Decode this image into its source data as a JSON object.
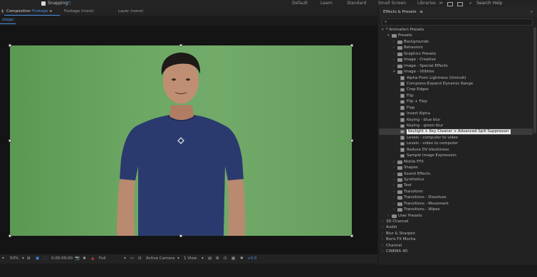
{
  "topbar": {
    "snapping_label": "Snapping",
    "workspaces": [
      "Default",
      "Learn",
      "Standard",
      "Small Screen",
      "Libraries"
    ],
    "search_help": "Search Help"
  },
  "left_panel": {
    "tabs": {
      "composition_prefix": "Composition",
      "composition_name": "Footage",
      "footage": "Footage (none)",
      "layer": "Layer (none)"
    },
    "subtab": "otage"
  },
  "viewer_bar": {
    "zoom": "50%",
    "timecode": "0:00:00:00",
    "resolution": "Full",
    "camera": "Active Camera",
    "views": "1 View",
    "exposure": "+0.0"
  },
  "effects_panel": {
    "title": "Effects & Presets",
    "search_placeholder": "",
    "items": [
      {
        "label": "* Animation Presets",
        "level": 0,
        "type": "root",
        "open": true
      },
      {
        "label": "Presets",
        "level": 1,
        "type": "folder",
        "open": true
      },
      {
        "label": "Backgrounds",
        "level": 2,
        "type": "folder"
      },
      {
        "label": "Behaviors",
        "level": 2,
        "type": "folder"
      },
      {
        "label": "Graphics Presets",
        "level": 2,
        "type": "folder"
      },
      {
        "label": "Image - Creative",
        "level": 2,
        "type": "folder"
      },
      {
        "label": "Image - Special Effects",
        "level": 2,
        "type": "folder"
      },
      {
        "label": "Image - Utilities",
        "level": 2,
        "type": "folder",
        "open": true
      },
      {
        "label": "Alpha From Lightness (Unmult)",
        "level": 3,
        "type": "preset"
      },
      {
        "label": "Compress-Expand Dynamic Range",
        "level": 3,
        "type": "preset"
      },
      {
        "label": "Crop Edges",
        "level": 3,
        "type": "preset"
      },
      {
        "label": "Flip",
        "level": 3,
        "type": "preset"
      },
      {
        "label": "Flip + Flop",
        "level": 3,
        "type": "preset"
      },
      {
        "label": "Flop",
        "level": 3,
        "type": "preset"
      },
      {
        "label": "Invert Alpha",
        "level": 3,
        "type": "preset"
      },
      {
        "label": "Keying - blue blur",
        "level": 3,
        "type": "preset"
      },
      {
        "label": "Keying - green blur",
        "level": 3,
        "type": "preset"
      },
      {
        "label": "Keylight + Key Cleaner + Advanced Spill Suppressor",
        "level": 3,
        "type": "preset",
        "selected": true
      },
      {
        "label": "Levels - computer to video",
        "level": 3,
        "type": "preset"
      },
      {
        "label": "Levels - video to computer",
        "level": 3,
        "type": "preset"
      },
      {
        "label": "Reduce DV blockiness",
        "level": 3,
        "type": "preset"
      },
      {
        "label": "Sample Image Expression",
        "level": 3,
        "type": "preset"
      },
      {
        "label": "Motile FFX",
        "level": 2,
        "type": "folder"
      },
      {
        "label": "Shapes",
        "level": 2,
        "type": "folder"
      },
      {
        "label": "Sound Effects",
        "level": 2,
        "type": "folder"
      },
      {
        "label": "Synthetics",
        "level": 2,
        "type": "folder"
      },
      {
        "label": "Text",
        "level": 2,
        "type": "folder"
      },
      {
        "label": "Transform",
        "level": 2,
        "type": "folder"
      },
      {
        "label": "Transitions - Dissolves",
        "level": 2,
        "type": "folder"
      },
      {
        "label": "Transitions - Movement",
        "level": 2,
        "type": "folder"
      },
      {
        "label": "Transitions - Wipes",
        "level": 2,
        "type": "folder"
      },
      {
        "label": "User Presets",
        "level": 1,
        "type": "folder"
      },
      {
        "label": "3D Channel",
        "level": 0,
        "type": "category"
      },
      {
        "label": "Audio",
        "level": 0,
        "type": "category"
      },
      {
        "label": "Blur & Sharpen",
        "level": 0,
        "type": "category"
      },
      {
        "label": "Boris FX Mocha",
        "level": 0,
        "type": "category"
      },
      {
        "label": "Channel",
        "level": 0,
        "type": "category"
      },
      {
        "label": "CINEMA 4D",
        "level": 0,
        "type": "category"
      }
    ]
  },
  "colors": {
    "accent": "#4a90e2",
    "green_screen": "#6da865",
    "shirt": "#2b3a6e",
    "panel_bg": "#222222"
  }
}
